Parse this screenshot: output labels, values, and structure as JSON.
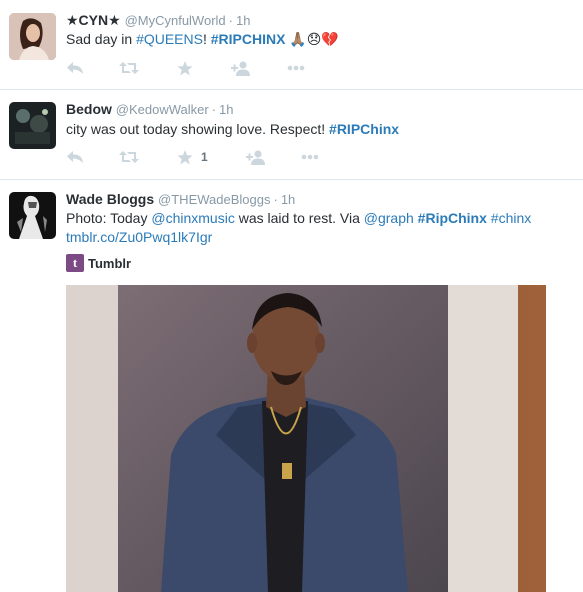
{
  "tweets": [
    {
      "name": "★CYN★",
      "handle": "@MyCynfulWorld",
      "time": "1h",
      "text_plain": "Sad day in ",
      "hashtag1": "#QUEENS",
      "mid": "! ",
      "hashtag2": "#RIPCHINX",
      "emoji": "🙏🏽😞💔",
      "favorite_count": ""
    },
    {
      "name": "Bedow",
      "handle": "@KedowWalker",
      "time": "1h",
      "text_plain": "city was out today showing love. Respect! ",
      "hashtag1": "#RIPChinx",
      "favorite_count": "1"
    },
    {
      "name": "Wade Bloggs",
      "handle": "@THEWadeBloggs",
      "time": "1h",
      "line1_a": "Photo: Today ",
      "mention1": "@chinxmusic",
      "line1_b": " was laid to rest. Via ",
      "mention2": "@graph",
      "line1_c": " ",
      "hashtag1": "#RipChinx",
      "line1_d": " ",
      "hashtag2": "#chinx",
      "link": "tmblr.co/Zu0Pwq1lk7Igr",
      "card_source": "Tumblr",
      "card_icon": "t"
    }
  ],
  "colors": {
    "link": "#2b7bb9",
    "muted": "#8899a6",
    "action": "#ccd6dd",
    "divider": "#e1e8ed"
  }
}
